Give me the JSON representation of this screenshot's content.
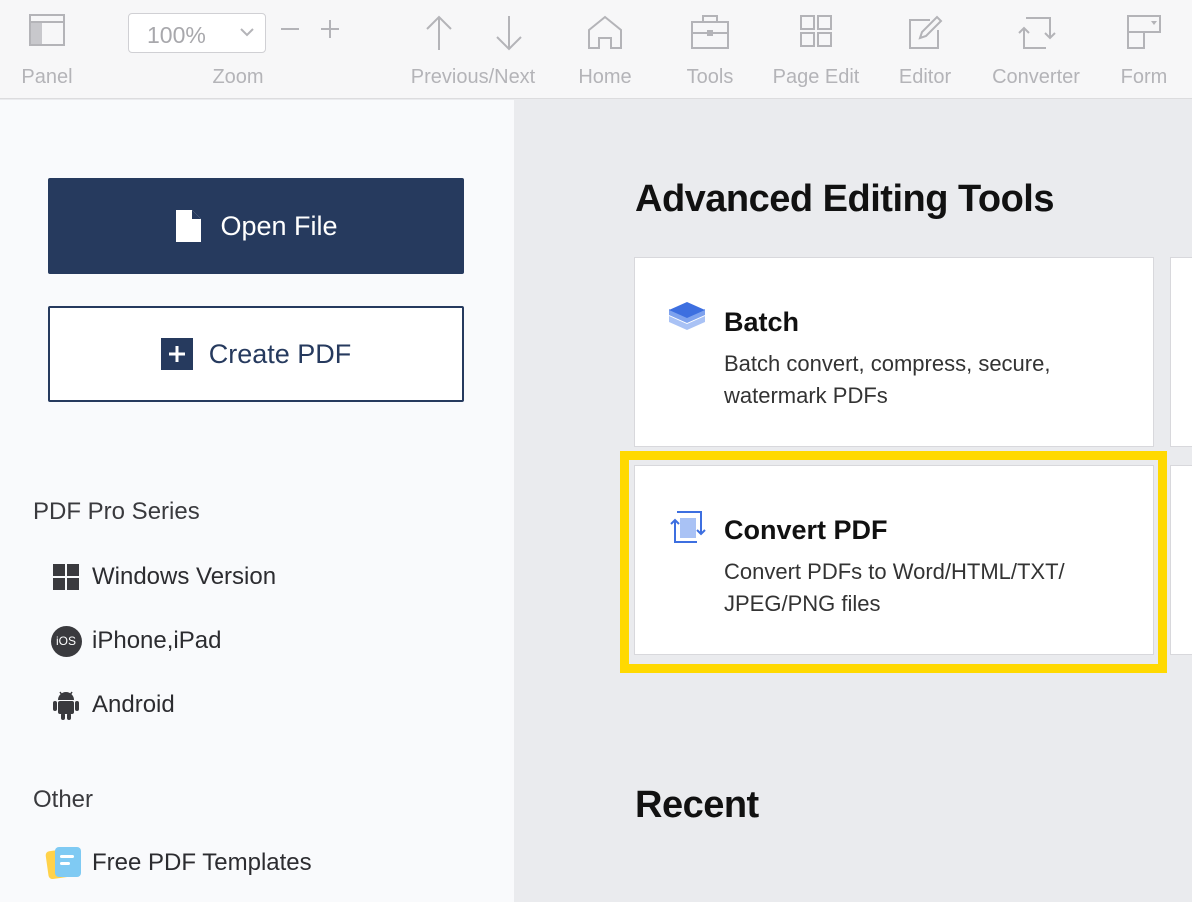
{
  "toolbar": {
    "panel_label": "Panel",
    "zoom_label": "Zoom",
    "zoom_value": "100%",
    "prevnext_label": "Previous/Next",
    "home_label": "Home",
    "tools_label": "Tools",
    "pageedit_label": "Page Edit",
    "editor_label": "Editor",
    "converter_label": "Converter",
    "form_label": "Form"
  },
  "sidebar": {
    "open_file": "Open File",
    "create_pdf": "Create PDF",
    "series_heading": "PDF Pro Series",
    "series_items": [
      {
        "label": "Windows Version",
        "icon": "windows-icon"
      },
      {
        "label": "iPhone,iPad",
        "icon": "ios-icon"
      },
      {
        "label": "Android",
        "icon": "android-icon"
      }
    ],
    "ios_badge": "iOS",
    "other_heading": "Other",
    "other_items": [
      {
        "label": "Free PDF Templates",
        "icon": "templates-icon"
      }
    ]
  },
  "main": {
    "advanced_title": "Advanced Editing Tools",
    "cards": [
      {
        "title": "Batch",
        "desc": "Batch convert, compress, secure, watermark PDFs",
        "icon": "layers-icon"
      },
      {
        "title": "Convert PDF",
        "desc": "Convert PDFs to Word/HTML/TXT/ JPEG/PNG files",
        "icon": "convert-icon"
      }
    ],
    "recent_title": "Recent"
  },
  "colors": {
    "accent": "#263a5e",
    "highlight": "#ffd900",
    "toolbar_text": "#b4b4b8",
    "main_bg": "#eaebee"
  }
}
